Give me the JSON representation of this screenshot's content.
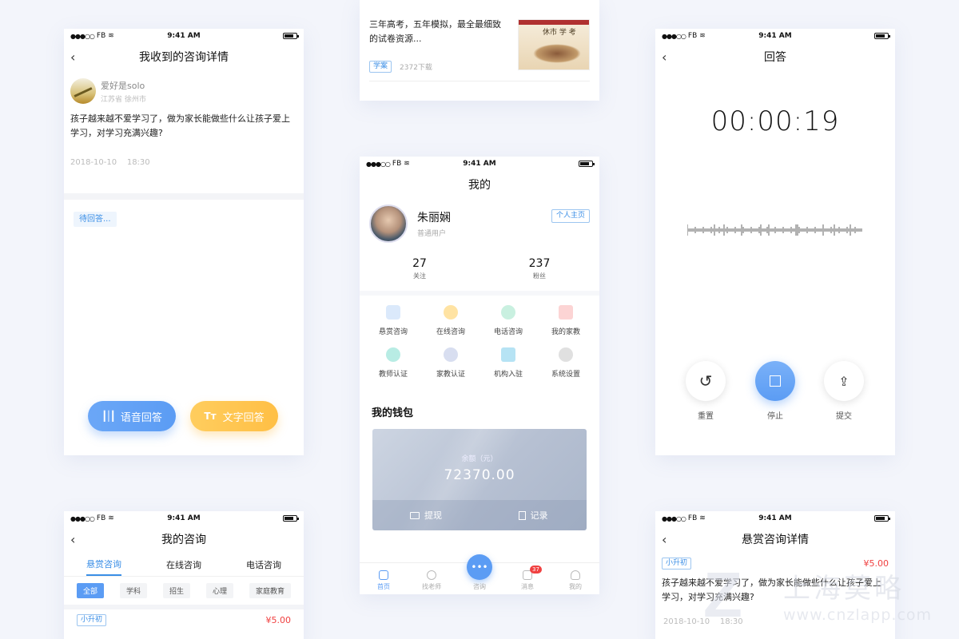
{
  "status": {
    "carrier": "FB",
    "time": "9:41 AM"
  },
  "detail": {
    "title": "我收到的咨询详情",
    "user": {
      "name": "爱好是solo",
      "location": "江苏省  徐州市"
    },
    "question": "孩子越来越不爱学习了，做为家长能做些什么让孩子爱上学习，对学习充满兴趣?",
    "datetime": "2018-10-10    18:30",
    "status_tag": "待回答...",
    "voice_btn": "语音回答",
    "text_btn": "文字回答"
  },
  "resource": {
    "text": "三年高考，五年模拟，最全最细致的试卷资源...",
    "tag": "学案",
    "downloads": "2372下载",
    "thumb_text": "休市 学 考"
  },
  "mine": {
    "title": "我的",
    "name": "朱丽娴",
    "role": "普通用户",
    "homepage_btn": "个人主页",
    "follow_count": "27",
    "follow_label": "关注",
    "fans_count": "237",
    "fans_label": "粉丝",
    "menu": [
      "悬赏咨询",
      "在线咨询",
      "电话咨询",
      "我的家教",
      "教师认证",
      "家教认证",
      "机构入驻",
      "系统设置"
    ],
    "wallet_title": "我的钱包",
    "balance_label": "余额（元）",
    "balance": "72370.00",
    "withdraw": "提现",
    "records": "记录",
    "tabs": [
      "首页",
      "找老师",
      "咨询",
      "消息",
      "我的"
    ],
    "badge": "37"
  },
  "answer": {
    "title": "回答",
    "timer": "00:00:19",
    "reset": "重置",
    "stop": "停止",
    "submit": "提交"
  },
  "myconsult": {
    "title": "我的咨询",
    "tabs": [
      "悬赏咨询",
      "在线咨询",
      "电话咨询"
    ],
    "chips": [
      "全部",
      "学科",
      "招生",
      "心理",
      "家庭教育"
    ],
    "tag": "小升初",
    "price": "¥5.00"
  },
  "reward": {
    "title": "悬赏咨询详情",
    "tag": "小升初",
    "price": "¥5.00",
    "question": "孩子越来越不爱学习了，做为家长能做些什么让孩子爱上学习，对学习充满兴趣?",
    "datetime": "2018-10-10    18:30"
  },
  "watermark": {
    "brand": "上海莫略",
    "url": "www.cnzlapp.com"
  },
  "colors": {
    "blue": "#5b9cf4",
    "orange": "#ffc24a",
    "red": "#f04040"
  }
}
